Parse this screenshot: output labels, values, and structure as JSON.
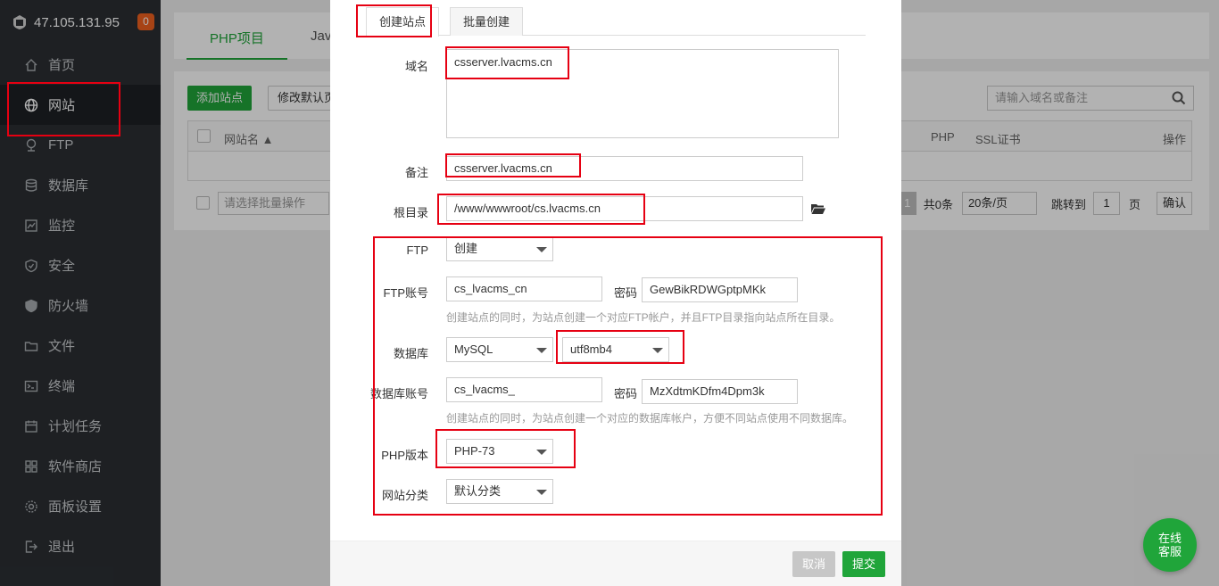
{
  "sidebar": {
    "server_ip": "47.105.131.95",
    "notification_count": "0",
    "items": [
      {
        "label": "首页",
        "icon": "home-icon"
      },
      {
        "label": "网站",
        "icon": "globe-icon"
      },
      {
        "label": "FTP",
        "icon": "ftp-icon"
      },
      {
        "label": "数据库",
        "icon": "database-icon"
      },
      {
        "label": "监控",
        "icon": "monitor-icon"
      },
      {
        "label": "安全",
        "icon": "shield-icon"
      },
      {
        "label": "防火墙",
        "icon": "firewall-icon"
      },
      {
        "label": "文件",
        "icon": "folder-icon"
      },
      {
        "label": "终端",
        "icon": "terminal-icon"
      },
      {
        "label": "计划任务",
        "icon": "calendar-icon"
      },
      {
        "label": "软件商店",
        "icon": "apps-icon"
      },
      {
        "label": "面板设置",
        "icon": "gear-icon"
      },
      {
        "label": "退出",
        "icon": "logout-icon"
      }
    ]
  },
  "main": {
    "tabs": [
      "PHP项目",
      "Jav"
    ],
    "add_site": "添加站点",
    "modify_default": "修改默认页",
    "search_placeholder": "请输入域名或备注",
    "columns": {
      "name": "网站名 ▲",
      "php": "PHP",
      "ssl": "SSL证书",
      "ops": "操作"
    },
    "batch_placeholder": "请选择批量操作",
    "pager": {
      "current": "1",
      "total": "共0条",
      "per_page": "20条/页",
      "goto": "跳转到",
      "page_num": "1",
      "page_unit": "页",
      "confirm": "确认"
    }
  },
  "modal": {
    "tabs": [
      "创建站点",
      "批量创建"
    ],
    "domain_label": "域名",
    "domain_value": "csserver.lvacms.cn",
    "remark_label": "备注",
    "remark_value": "csserver.lvacms.cn",
    "root_label": "根目录",
    "root_value": "/www/wwwroot/cs.lvacms.cn",
    "ftp_label": "FTP",
    "ftp_value": "创建",
    "ftp_account_label": "FTP账号",
    "ftp_account_value": "cs_lvacms_cn",
    "ftp_password_label": "密码",
    "ftp_password_value": "GewBikRDWGptpMKk",
    "ftp_hint": "创建站点的同时，为站点创建一个对应FTP帐户，并且FTP目录指向站点所在目录。",
    "db_label": "数据库",
    "db_type": "MySQL",
    "db_charset": "utf8mb4",
    "db_account_label": "数据库账号",
    "db_account_value": "cs_lvacms_",
    "db_password_label": "密码",
    "db_password_value": "MzXdtmKDfm4Dpm3k",
    "db_hint": "创建站点的同时，为站点创建一个对应的数据库帐户，方便不同站点使用不同数据库。",
    "php_label": "PHP版本",
    "php_value": "PHP-73",
    "category_label": "网站分类",
    "category_value": "默认分类",
    "cancel": "取消",
    "submit": "提交"
  },
  "chat": {
    "line1": "在线",
    "line2": "客服"
  },
  "colors": {
    "accent": "#20a53a",
    "annotation": "#e60012",
    "sidebar": "#2b2f33"
  }
}
